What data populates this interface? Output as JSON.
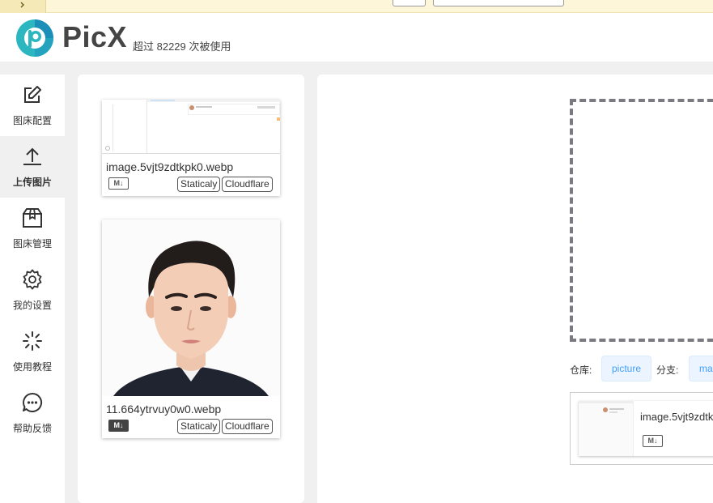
{
  "app": {
    "brand": "PicX",
    "usage_text": "超过 82229 次被使用"
  },
  "sidebar": {
    "items": [
      {
        "label": "图床配置",
        "icon": "edit-icon"
      },
      {
        "label": "上传图片",
        "icon": "upload-icon",
        "active": true
      },
      {
        "label": "图床管理",
        "icon": "box-icon"
      },
      {
        "label": "我的设置",
        "icon": "gear-icon"
      },
      {
        "label": "使用教程",
        "icon": "loader-icon"
      },
      {
        "label": "帮助反馈",
        "icon": "chat-icon"
      }
    ]
  },
  "uploaded": {
    "items": [
      {
        "filename": "image.5vjt9zdtkpk0.webp",
        "md_badge": "M↓",
        "tags": [
          "Staticaly",
          "Cloudflare"
        ]
      },
      {
        "filename": "11.664ytrvuy0w0.webp",
        "md_badge": "M↓",
        "tags": [
          "Staticaly",
          "Cloudflare"
        ]
      }
    ]
  },
  "upload": {
    "repo_label": "仓库:",
    "repo_value": "picture",
    "branch_label": "分支:",
    "branch_value": "mas",
    "preview_filename": "image.5vjt9zdtk",
    "preview_md_badge": "M↓"
  },
  "colors": {
    "accent": "#409eff",
    "chip_bg": "#ecf5ff",
    "notice_bg": "#fdf6d8",
    "logo_teal": "#2bb6c0"
  }
}
